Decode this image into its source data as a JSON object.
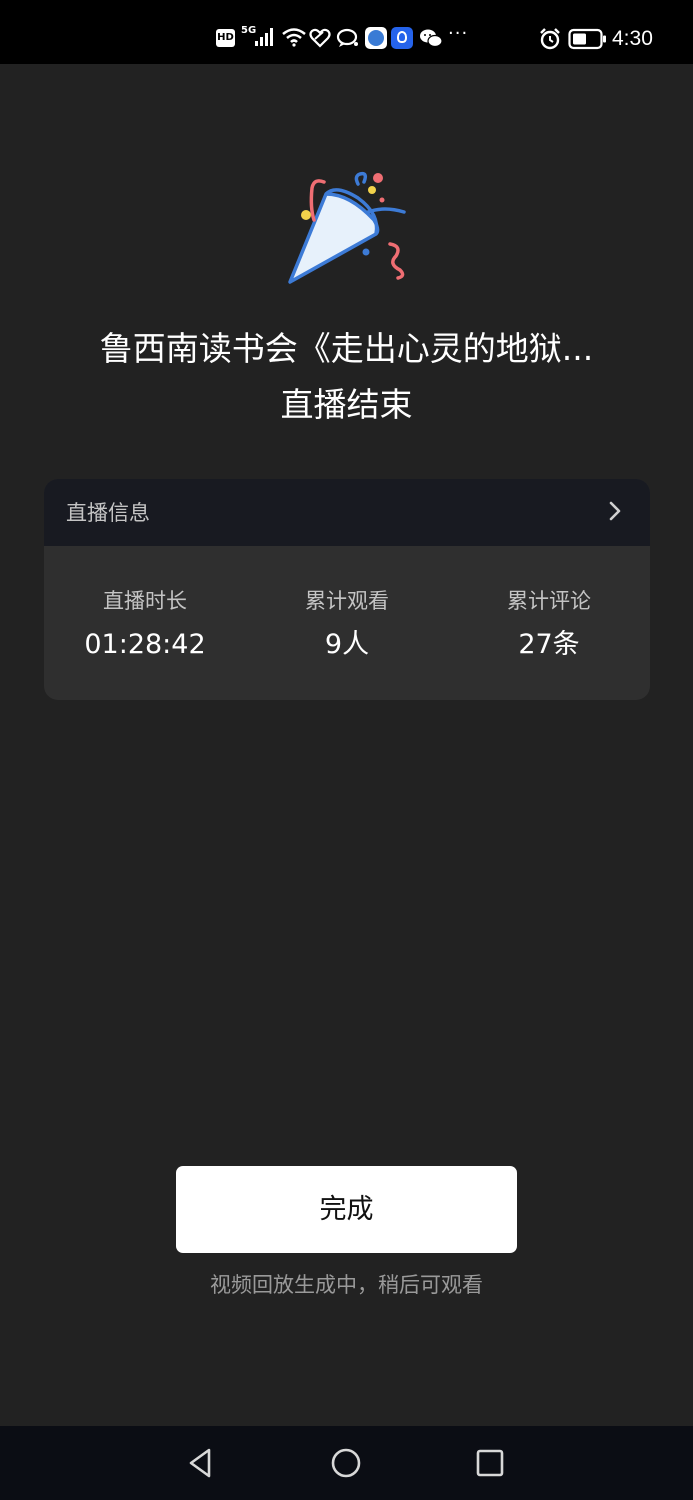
{
  "status_bar": {
    "network_badge": "HD",
    "network_type": "5G",
    "more_indicator": "···",
    "time": "4:30",
    "icons": [
      "hd-icon",
      "signal-icon",
      "wifi-icon",
      "heart-icon",
      "chat-bubble-icon",
      "browser-app-icon",
      "bulb-app-icon",
      "wechat-icon",
      "more-dots-icon",
      "alarm-icon",
      "battery-icon"
    ]
  },
  "header": {
    "icon": "party-popper-icon",
    "title": "鲁西南读书会《走出心灵的地狱...",
    "subtitle": "直播结束"
  },
  "info_card": {
    "title": "直播信息",
    "chevron_icon": "chevron-right-icon",
    "stats": [
      {
        "label": "直播时长",
        "value": "01:28:42"
      },
      {
        "label": "累计观看",
        "value": "9人"
      },
      {
        "label": "累计评论",
        "value": "27条"
      }
    ]
  },
  "actions": {
    "done_label": "完成",
    "hint": "视频回放生成中，稍后可观看"
  },
  "nav_bar": {
    "buttons": [
      "back-icon",
      "home-icon",
      "recents-icon"
    ]
  },
  "colors": {
    "background": "#222222",
    "card": "#2f2f2f",
    "card_header": "#181a21",
    "button": "#ffffff"
  }
}
